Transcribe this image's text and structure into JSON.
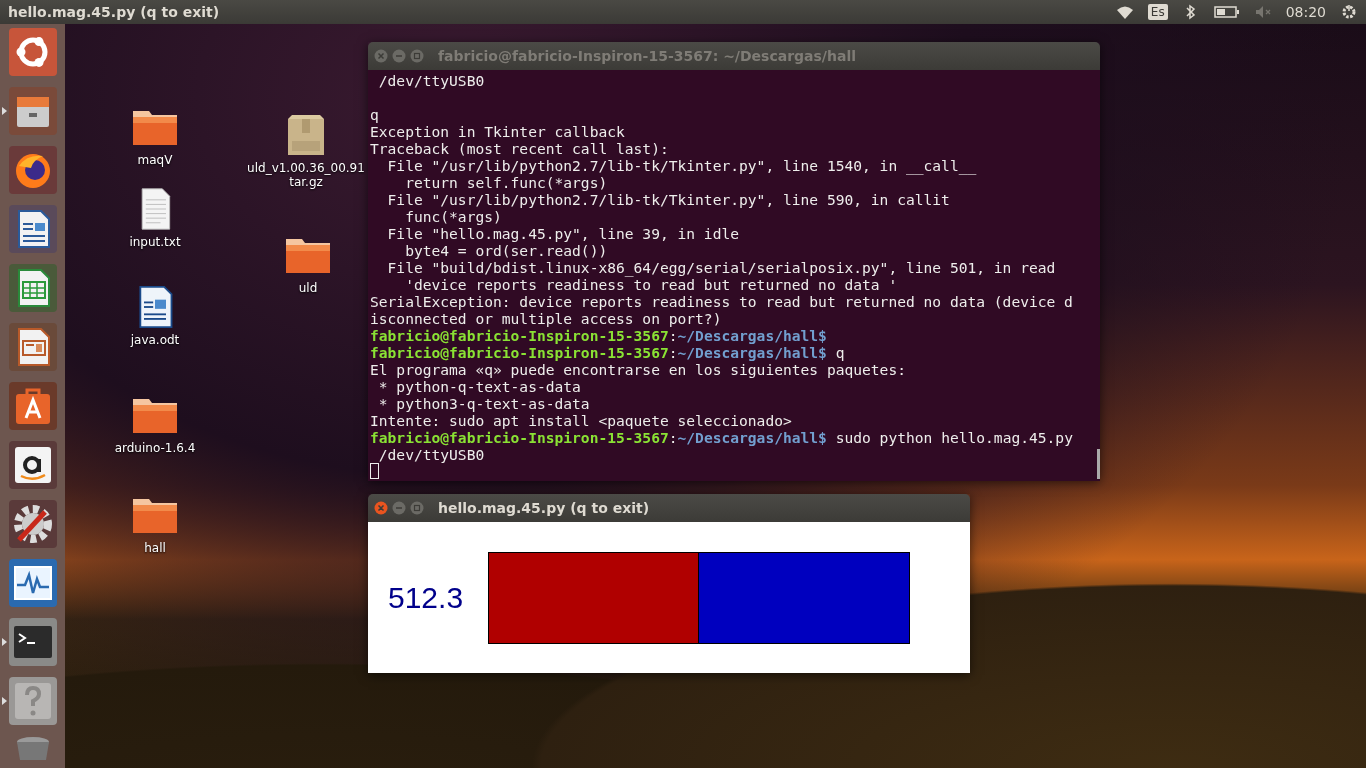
{
  "top_panel": {
    "title": "hello.mag.45.py (q to exit)",
    "keyboard_layout": "Es",
    "time": "08:20"
  },
  "launcher": [
    {
      "kind": "ubuntu",
      "running": false
    },
    {
      "kind": "files",
      "running": true
    },
    {
      "kind": "firefox",
      "running": false
    },
    {
      "kind": "writer",
      "running": false
    },
    {
      "kind": "calc",
      "running": false
    },
    {
      "kind": "impress",
      "running": false
    },
    {
      "kind": "software",
      "running": false
    },
    {
      "kind": "amazon",
      "running": false
    },
    {
      "kind": "settings",
      "running": false
    },
    {
      "kind": "monitor",
      "running": false
    },
    {
      "kind": "terminal",
      "running": true
    },
    {
      "kind": "help",
      "running": true
    },
    {
      "kind": "trash",
      "running": false
    }
  ],
  "desktop_icons": [
    {
      "kind": "folder",
      "name": "maqV"
    },
    {
      "kind": "text",
      "name": "input.txt"
    },
    {
      "kind": "document",
      "name": "java.odt"
    },
    {
      "kind": "folder",
      "name": "arduino-1.6.4"
    },
    {
      "kind": "folder",
      "name": "hall"
    },
    {
      "kind": "archive",
      "name": "uld_v1.00.36_00.91\ntar.gz"
    },
    {
      "kind": "folder",
      "name": "uld"
    }
  ],
  "terminal": {
    "title": "fabricio@fabricio-Inspiron-15-3567: ~/Descargas/hall",
    "lines": [
      {
        "kind": "output",
        "text": " /dev/ttyUSB0"
      },
      {
        "kind": "blank"
      },
      {
        "kind": "output",
        "text": "q"
      },
      {
        "kind": "output",
        "text": "Exception in Tkinter callback"
      },
      {
        "kind": "output",
        "text": "Traceback (most recent call last):"
      },
      {
        "kind": "output",
        "text": "  File \"/usr/lib/python2.7/lib-tk/Tkinter.py\", line 1540, in __call__"
      },
      {
        "kind": "output",
        "text": "    return self.func(*args)"
      },
      {
        "kind": "output",
        "text": "  File \"/usr/lib/python2.7/lib-tk/Tkinter.py\", line 590, in callit"
      },
      {
        "kind": "output",
        "text": "    func(*args)"
      },
      {
        "kind": "output",
        "text": "  File \"hello.mag.45.py\", line 39, in idle"
      },
      {
        "kind": "output",
        "text": "    byte4 = ord(ser.read())"
      },
      {
        "kind": "output",
        "text": "  File \"build/bdist.linux-x86_64/egg/serial/serialposix.py\", line 501, in read"
      },
      {
        "kind": "output",
        "text": "    'device reports readiness to read but returned no data '"
      },
      {
        "kind": "output",
        "text": "SerialException: device reports readiness to read but returned no data (device d"
      },
      {
        "kind": "output",
        "text": "isconnected or multiple access on port?)"
      },
      {
        "kind": "prompt",
        "user": "fabricio@fabricio-Inspiron-15-3567",
        "separator": ":",
        "path": "~/Descargas/hall$"
      },
      {
        "kind": "prompt",
        "user": "fabricio@fabricio-Inspiron-15-3567",
        "separator": ":",
        "path": "~/Descargas/hall$",
        "command": " q"
      },
      {
        "kind": "output",
        "text": "El programa «q» puede encontrarse en los siguientes paquetes:"
      },
      {
        "kind": "output",
        "text": " * python-q-text-as-data"
      },
      {
        "kind": "output",
        "text": " * python3-q-text-as-data"
      },
      {
        "kind": "output",
        "text": "Intente: sudo apt install <paquete seleccionado>"
      },
      {
        "kind": "prompt",
        "user": "fabricio@fabricio-Inspiron-15-3567",
        "separator": ":",
        "path": "~/Descargas/hall$",
        "command": " sudo python hello.mag.45.py"
      },
      {
        "kind": "output",
        "text": " /dev/ttyUSB0"
      }
    ]
  },
  "tk_window": {
    "title": "hello.mag.45.py (q to exit)",
    "value": "512.3",
    "meter": {
      "level": 0.5
    }
  }
}
